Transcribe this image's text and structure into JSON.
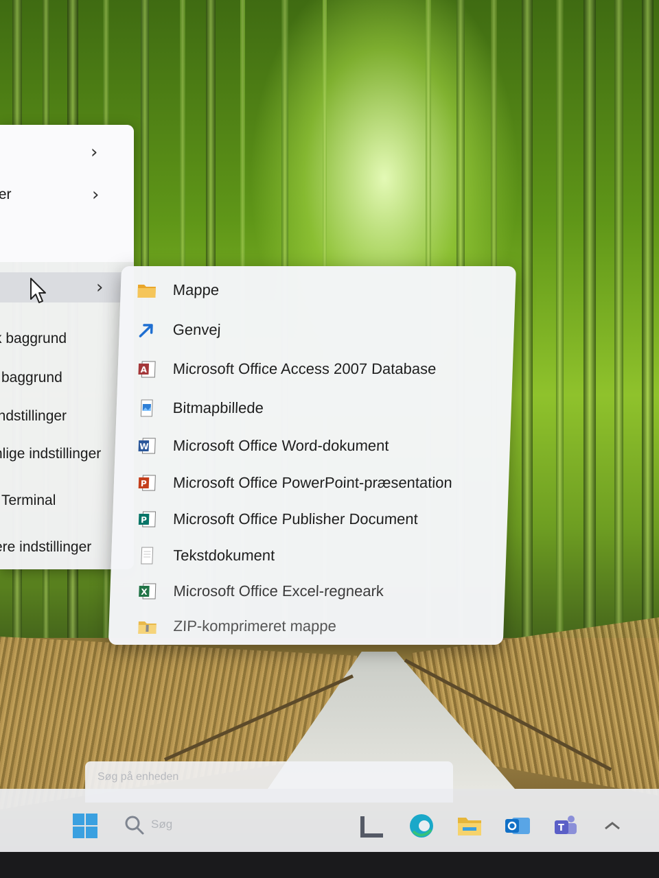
{
  "parent_menu": {
    "items": [
      {
        "label": "",
        "has_submenu": true
      },
      {
        "label": "ter",
        "has_submenu": true
      },
      {
        "label": "",
        "has_submenu": true,
        "highlighted": true
      },
      {
        "label": "k baggrund"
      },
      {
        "label": "baggrund"
      },
      {
        "label": "indstillinger"
      },
      {
        "label": "nlige indstillinger"
      },
      {
        "label": "Terminal"
      },
      {
        "label": "ere indstillinger"
      }
    ]
  },
  "submenu": {
    "items": [
      {
        "label": "Mappe",
        "icon": "folder-icon"
      },
      {
        "label": "Genvej",
        "icon": "shortcut-arrow-icon"
      },
      {
        "label": "Microsoft Office Access 2007 Database",
        "icon": "access-database-icon"
      },
      {
        "label": "Bitmapbillede",
        "icon": "bitmap-image-icon"
      },
      {
        "label": "Microsoft Office Word-dokument",
        "icon": "word-document-icon"
      },
      {
        "label": "Microsoft Office PowerPoint-præsentation",
        "icon": "powerpoint-icon"
      },
      {
        "label": "Microsoft Office Publisher Document",
        "icon": "publisher-icon"
      },
      {
        "label": "Tekstdokument",
        "icon": "text-document-icon"
      },
      {
        "label": "Microsoft Office Excel-regneark",
        "icon": "excel-icon"
      },
      {
        "label": "ZIP-komprimeret mappe",
        "icon": "zip-folder-icon"
      }
    ]
  },
  "taskbar": {
    "search_placeholder": "Søg",
    "popup_placeholder": "Søg på enheden",
    "icons": [
      "start-icon",
      "search-icon",
      "app-icon",
      "edge-icon",
      "file-explorer-icon",
      "outlook-icon",
      "teams-icon",
      "chevron-icon"
    ]
  },
  "colors": {
    "menu_bg": "#f3f3f6",
    "folder": "#f2b63c",
    "word": "#2b579a",
    "powerpoint": "#c43e1c",
    "excel": "#217346",
    "access": "#a4373a",
    "publisher": "#077568",
    "accent": "#0f6cbd"
  }
}
